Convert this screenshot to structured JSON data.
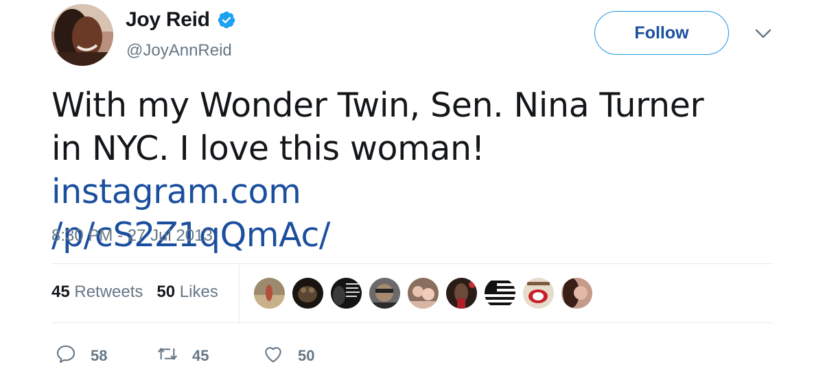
{
  "author": {
    "name": "Joy Reid",
    "handle": "@JoyAnnReid",
    "verified": true
  },
  "follow_label": "Follow",
  "tweet": {
    "text": "With my Wonder Twin, Sen. Nina Turner in NYC. I love this woman! ",
    "link_line1": "instagram.com",
    "link_line2": "/p/cS2Z1qQmAc/",
    "timestamp": "8:30 PM - 27 Jul 2013"
  },
  "stats": {
    "retweets_count": "45",
    "retweets_label": "Retweets",
    "likes_count": "50",
    "likes_label": "Likes"
  },
  "actions": {
    "reply_count": "58",
    "retweet_count": "45",
    "like_count": "50"
  },
  "colors": {
    "link": "#1b4f9e",
    "muted": "#657786",
    "verified_badge": "#1da1f2",
    "divider": "#e6ecf0"
  }
}
